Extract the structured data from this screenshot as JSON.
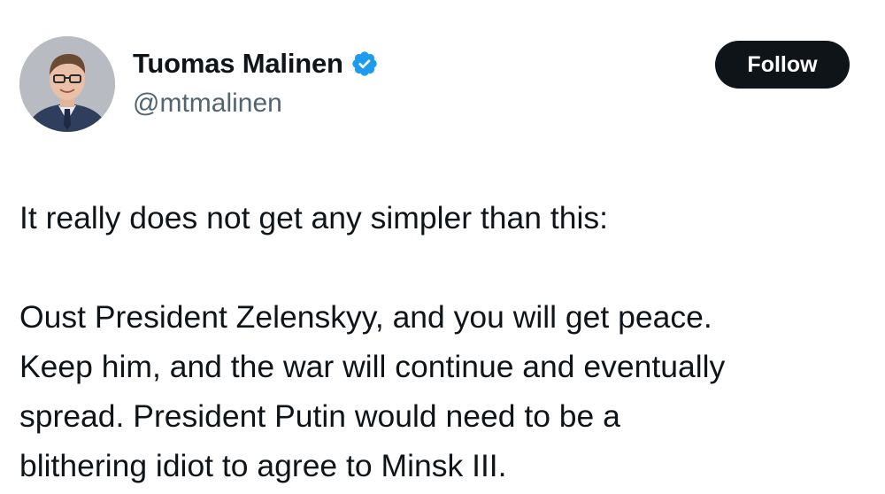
{
  "author": {
    "display_name": "Tuomas Malinen",
    "handle": "@mtmalinen",
    "verified": true,
    "verified_icon": "verified-badge-icon",
    "avatar_icon": "profile-photo"
  },
  "actions": {
    "follow_label": "Follow"
  },
  "tweet": {
    "lines": [
      "It really does not get any simpler than this:",
      "Oust President Zelenskyy, and you will get peace.",
      "Keep him, and the war will continue and eventually",
      "spread. President Putin would need to be a",
      "blithering idiot to agree to Minsk III."
    ]
  },
  "colors": {
    "verified_blue": "#1d9bf0",
    "button_bg": "#0f1419",
    "secondary_text": "#536471"
  }
}
